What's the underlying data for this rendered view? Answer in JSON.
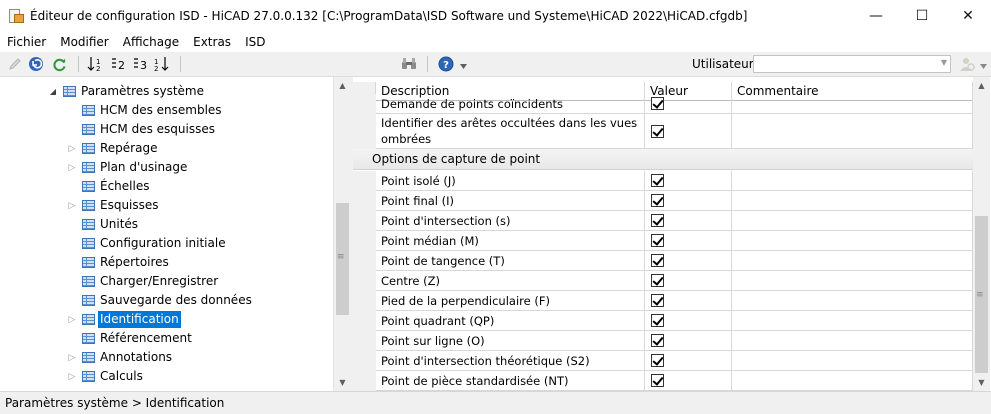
{
  "window": {
    "title": "Éditeur de configuration ISD  -  HiCAD 27.0.0.132 [C:\\ProgramData\\ISD Software und Systeme\\HiCAD 2022\\HiCAD.cfgdb]",
    "minimize_glyph": "—",
    "maximize_glyph": "☐",
    "close_glyph": "✕"
  },
  "menu": [
    "Fichier",
    "Modifier",
    "Affichage",
    "Extras",
    "ISD"
  ],
  "toolbar": {
    "user_label": "Utilisateur",
    "user_value": ""
  },
  "tree": {
    "root": "Paramètres système",
    "items": [
      {
        "label": "HCM des ensembles",
        "expandable": false,
        "selected": false
      },
      {
        "label": "HCM des esquisses",
        "expandable": false,
        "selected": false
      },
      {
        "label": "Repérage",
        "expandable": true,
        "selected": false
      },
      {
        "label": "Plan d'usinage",
        "expandable": true,
        "selected": false
      },
      {
        "label": "Échelles",
        "expandable": false,
        "selected": false
      },
      {
        "label": "Esquisses",
        "expandable": true,
        "selected": false
      },
      {
        "label": "Unités",
        "expandable": false,
        "selected": false
      },
      {
        "label": "Configuration initiale",
        "expandable": false,
        "selected": false
      },
      {
        "label": "Répertoires",
        "expandable": false,
        "selected": false
      },
      {
        "label": "Charger/Enregistrer",
        "expandable": false,
        "selected": false
      },
      {
        "label": "Sauvegarde des données",
        "expandable": false,
        "selected": false
      },
      {
        "label": "Identification",
        "expandable": true,
        "selected": true
      },
      {
        "label": "Référencement",
        "expandable": false,
        "selected": false
      },
      {
        "label": "Annotations",
        "expandable": true,
        "selected": false
      },
      {
        "label": "Calculs",
        "expandable": true,
        "selected": false
      }
    ]
  },
  "grid": {
    "columns": {
      "description": "Description",
      "value": "Valeur",
      "comment": "Commentaire"
    },
    "top_rows": [
      {
        "description": "Demande de points coïncidents",
        "checked": true,
        "comment": ""
      },
      {
        "description_line1": "Identifier des arêtes occultées dans les vues",
        "description_line2": "ombrées",
        "checked": true,
        "comment": ""
      }
    ],
    "section": "Options de capture de point",
    "rows": [
      {
        "description": "Point isolé (J)",
        "checked": true,
        "comment": ""
      },
      {
        "description": "Point final (I)",
        "checked": true,
        "comment": ""
      },
      {
        "description": "Point d'intersection (s)",
        "checked": true,
        "comment": ""
      },
      {
        "description": "Point médian (M)",
        "checked": true,
        "comment": ""
      },
      {
        "description": "Point de tangence (T)",
        "checked": true,
        "comment": ""
      },
      {
        "description": "Centre (Z)",
        "checked": true,
        "comment": ""
      },
      {
        "description": "Pied de la perpendiculaire (F)",
        "checked": true,
        "comment": ""
      },
      {
        "description": "Point quadrant (QP)",
        "checked": true,
        "comment": ""
      },
      {
        "description": "Point sur ligne (O)",
        "checked": true,
        "comment": ""
      },
      {
        "description": "Point d'intersection théorétique (S2)",
        "checked": true,
        "comment": ""
      },
      {
        "description": "Point de pièce standardisée (NT)",
        "checked": true,
        "comment": ""
      }
    ]
  },
  "status": {
    "breadcrumb": "Paramètres système > Identification"
  },
  "colors": {
    "selection": "#0078d7",
    "app_icon": "#e8a33c"
  }
}
